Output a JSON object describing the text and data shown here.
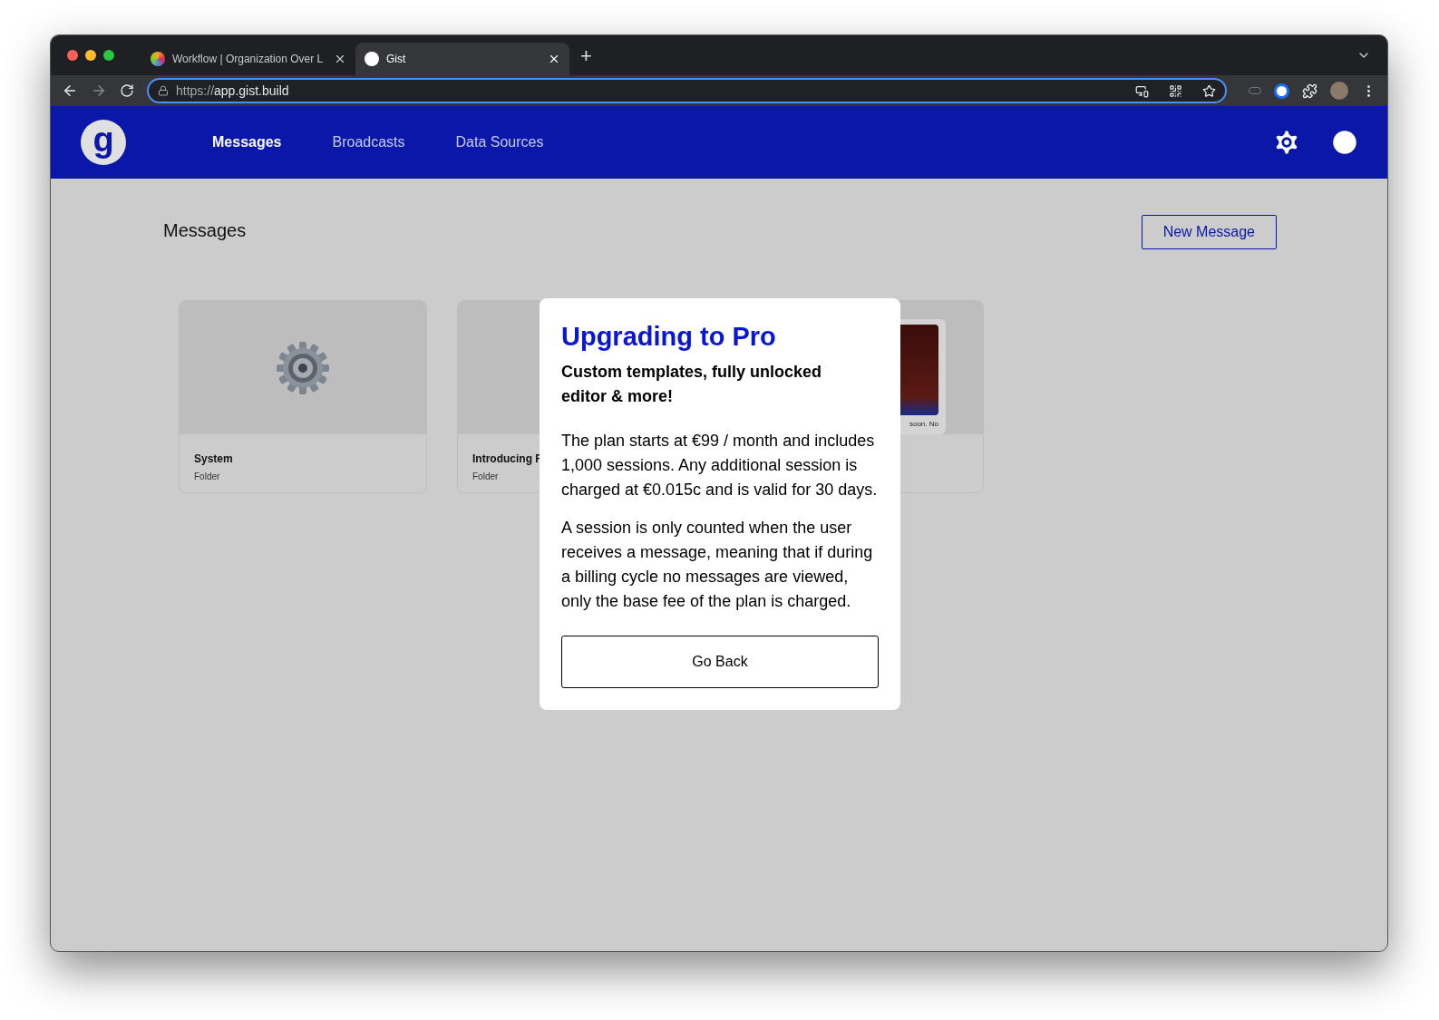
{
  "browser": {
    "tabs": [
      {
        "title": "Workflow | Organization Over L",
        "selected": false
      },
      {
        "title": "Gist",
        "selected": true
      }
    ],
    "new_tab": "+",
    "url_scheme": "https://",
    "url_host": "app.gist.build"
  },
  "nav": {
    "logo": "g",
    "items": [
      {
        "label": "Messages",
        "selected": true
      },
      {
        "label": "Broadcasts",
        "selected": false
      },
      {
        "label": "Data Sources",
        "selected": false
      }
    ]
  },
  "page": {
    "title": "Messages",
    "new_button": "New Message"
  },
  "cards": [
    {
      "kind": "gear",
      "title": "System",
      "subtitle": "Folder"
    },
    {
      "kind": "blank",
      "title": "Introducing F",
      "subtitle": "Folder"
    },
    {
      "kind": "preview",
      "caption": "soon. No"
    }
  ],
  "modal": {
    "title": "Upgrading to Pro",
    "subtitle": "Custom templates, fully unlocked editor & more!",
    "paragraphs": [
      "The plan starts at €99 / month and includes 1,000 sessions. Any additional session is charged at €0.015c and is valid for 30 days.",
      "A session is only counted when the user receives a message, meaning that if during a billing cycle no messages are viewed, only the base fee of the plan is charged."
    ],
    "button": "Go Back"
  }
}
